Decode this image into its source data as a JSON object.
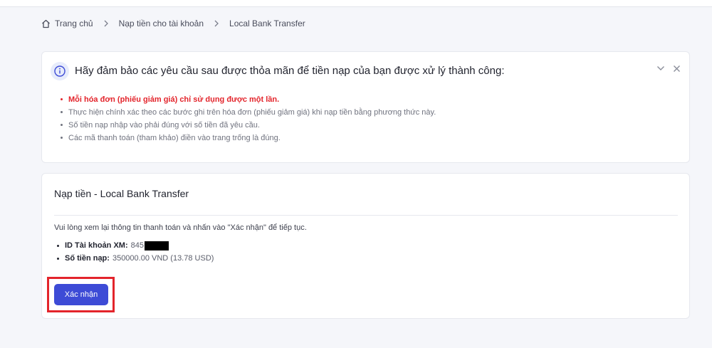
{
  "breadcrumb": {
    "home": "Trang chủ",
    "deposit": "Nạp tiền cho tài khoản",
    "current": "Local Bank Transfer"
  },
  "notice": {
    "title": "Hãy đảm bảo các yêu cầu sau được thỏa mãn để tiền nạp của bạn được xử lý thành công:",
    "items": [
      "Mỗi hóa đơn (phiếu giảm giá) chỉ sử dụng được một lần.",
      "Thực hiện chính xác theo các bước ghi trên hóa đơn (phiếu giảm giá) khi nạp tiền bằng phương thức này.",
      "Số tiền nạp nhập vào phải đúng với số tiền đã yêu cầu.",
      "Các mã thanh toán (tham khảo) điền vào trang trống là đúng."
    ],
    "icons": {
      "info": "info-icon",
      "collapse": "chevron-down-icon",
      "close": "close-icon"
    }
  },
  "deposit": {
    "title": "Nạp tiền - Local Bank Transfer",
    "instruction": "Vui lòng xem lại thông tin thanh toán và nhấn vào \"Xác nhận\" để tiếp tục.",
    "account_label": "ID Tài khoản XM:",
    "account_value": "845",
    "amount_label": "Số tiền nạp:",
    "amount_value": "350000.00 VND (13.78 USD)",
    "confirm_label": "Xác nhận"
  },
  "colors": {
    "accent": "#3d4bd6",
    "warning": "#e3242b",
    "highlight": "#e3242b"
  }
}
